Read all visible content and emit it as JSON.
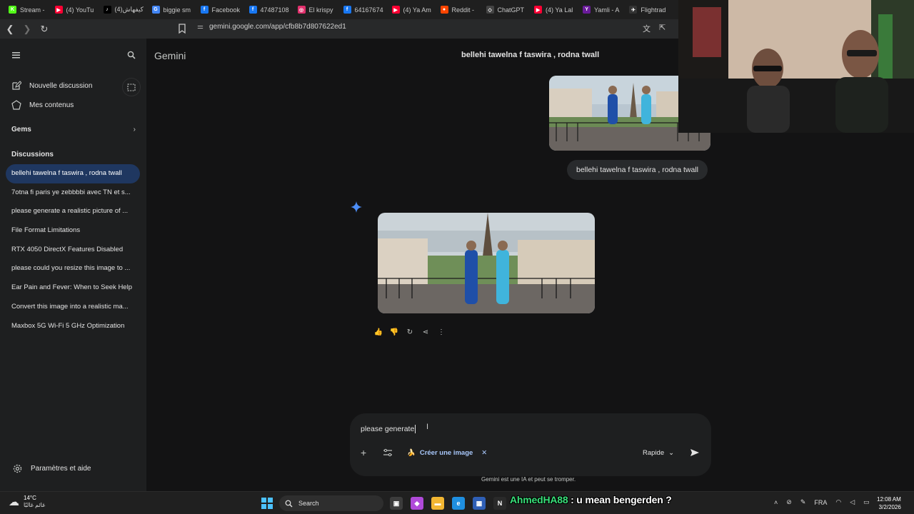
{
  "browser": {
    "tabs": [
      {
        "label": "Stream -",
        "color": "#53fc18",
        "glyph": "K"
      },
      {
        "label": "(4) YouTu",
        "color": "#ff0033",
        "glyph": "▶"
      },
      {
        "label": "كيفهاش(4)",
        "color": "#000000",
        "glyph": "♪"
      },
      {
        "label": "biggie sm",
        "color": "#4285f4",
        "glyph": "G"
      },
      {
        "label": "Facebook",
        "color": "#1877f2",
        "glyph": "f"
      },
      {
        "label": "47487108",
        "color": "#1877f2",
        "glyph": "f"
      },
      {
        "label": "El krispy",
        "color": "#e1306c",
        "glyph": "◎"
      },
      {
        "label": "64167674",
        "color": "#1877f2",
        "glyph": "f"
      },
      {
        "label": "(4) Ya Am",
        "color": "#ff0033",
        "glyph": "▶"
      },
      {
        "label": "Reddit -",
        "color": "#ff4500",
        "glyph": "●"
      },
      {
        "label": "ChatGPT",
        "color": "#444444",
        "glyph": "◇"
      },
      {
        "label": "(4) Ya Lal",
        "color": "#ff0033",
        "glyph": "▶"
      },
      {
        "label": "Yamli - A",
        "color": "#6a1b9a",
        "glyph": "Y"
      },
      {
        "label": "Flightrad",
        "color": "#333333",
        "glyph": "✈"
      }
    ],
    "url": "gemini.google.com/app/cfb8b7d807622ed1"
  },
  "sidebar": {
    "new_chat": "Nouvelle discussion",
    "my_content": "Mes contenus",
    "gems": "Gems",
    "discussions_heading": "Discussions",
    "chats": [
      "bellehi tawelna f taswira , rodna twall",
      "7otna fi paris ye zebbbbi avec TN et s...",
      "please generate a realistic picture of ...",
      "File Format Limitations",
      "RTX 4050 DirectX Features Disabled",
      "please could you resize this image to ...",
      "Ear Pain and Fever: When to Seek Help",
      "Convert this image into a realistic ma...",
      "Maxbox 5G Wi-Fi 5 GHz Optimization"
    ],
    "settings": "Paramètres et aide"
  },
  "main": {
    "brand": "Gemini",
    "conversation_title": "bellehi tawelna f taswira , rodna twall",
    "user_message": "bellehi tawelna f taswira , rodna twall",
    "composer_text": "please generate",
    "tool_chip": "Créer une image",
    "mode": "Rapide",
    "disclaimer": "Gemini est une IA et peut se tromper."
  },
  "taskbar": {
    "temperature": "14°C",
    "location": "غائم غالبًا",
    "search_label": "Search",
    "stream_user": "AhmedHA88",
    "stream_message": ": u mean bengerden ?",
    "language": "FRA",
    "time": "12:08 AM",
    "date": "3/2/2026"
  },
  "colors": {
    "accent": "#a8c7fa",
    "active_chat": "#1f3760",
    "background": "#131314",
    "sidebar": "#1e1f20"
  }
}
